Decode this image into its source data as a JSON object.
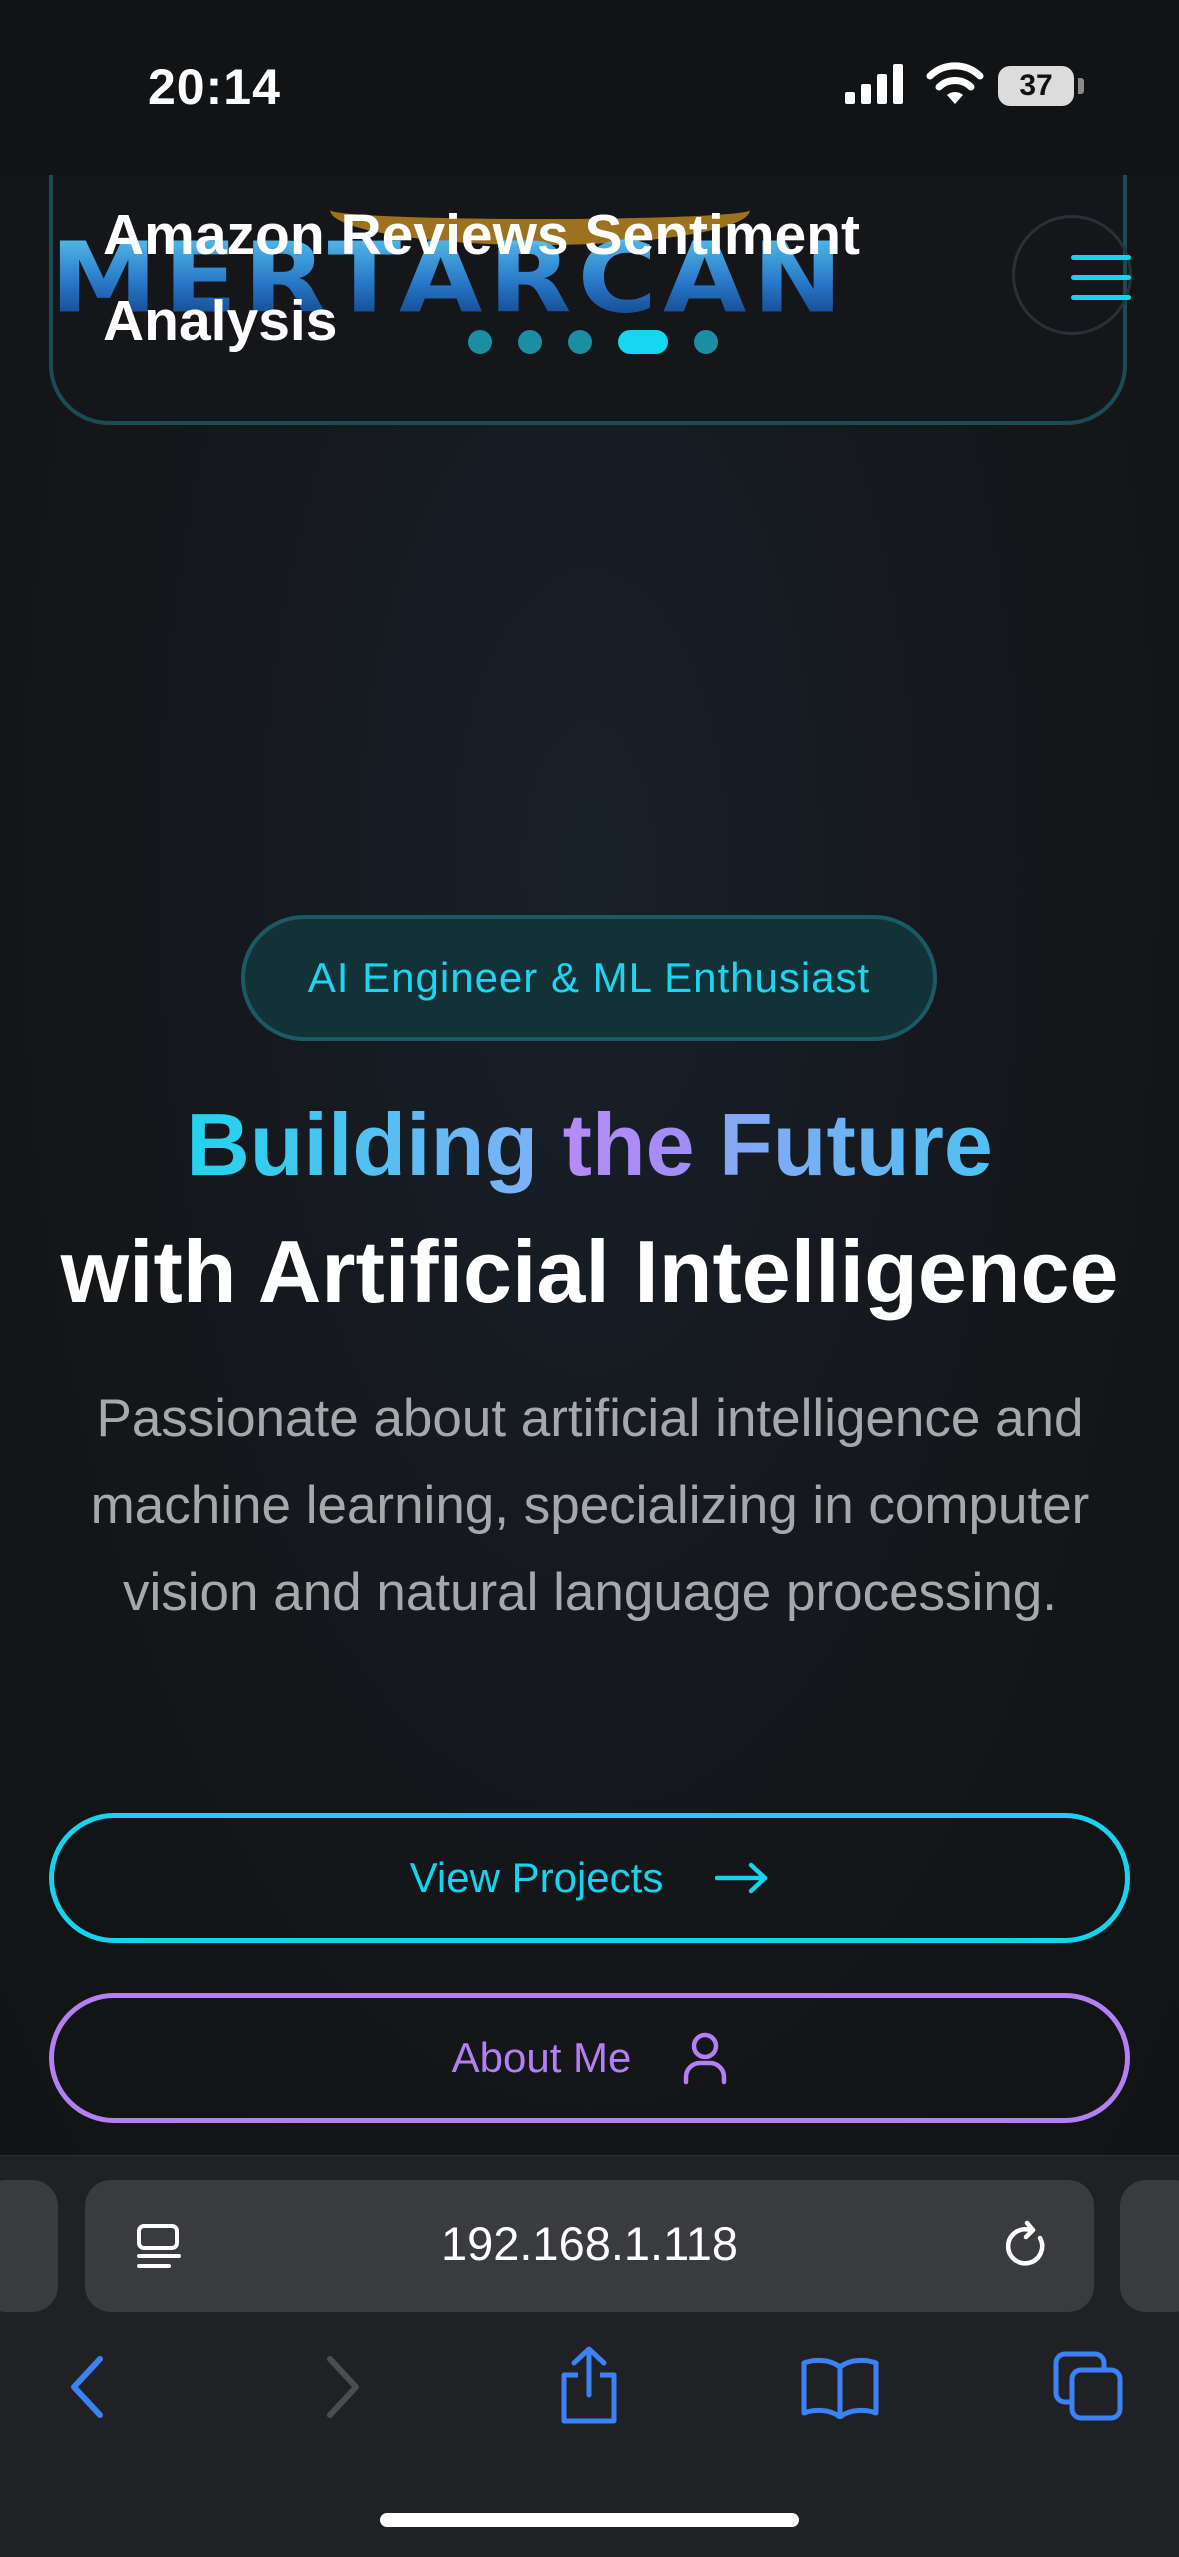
{
  "status_bar": {
    "time": "20:14",
    "battery": "37"
  },
  "project_card": {
    "title": "Amazon Reviews Sentiment Analysis",
    "carousel_index": 4,
    "carousel_count": 5
  },
  "logo": {
    "text": "MERTARCAN"
  },
  "hero": {
    "badge": "AI Engineer & ML Enthusiast",
    "headline_words": [
      "Building",
      "the",
      "Future"
    ],
    "headline_line2": "with Artificial Intelligence",
    "subtitle": "Passionate about artificial intelligence and machine learning, specializing in computer vision and natural language processing.",
    "buttons": {
      "view_projects": {
        "label": "View Projects",
        "icon": "arrow-right-icon"
      },
      "about_me": {
        "label": "About Me",
        "icon": "user-icon"
      }
    }
  },
  "browser": {
    "url": "192.168.1.118",
    "toolbar": [
      "back-icon",
      "forward-icon",
      "share-icon",
      "bookmarks-icon",
      "tabs-icon"
    ]
  },
  "colors": {
    "accent_cyan": "#17d3ee",
    "accent_purple": "#b57ff4",
    "background": "#131416",
    "ios_blue": "#3b82f6"
  }
}
